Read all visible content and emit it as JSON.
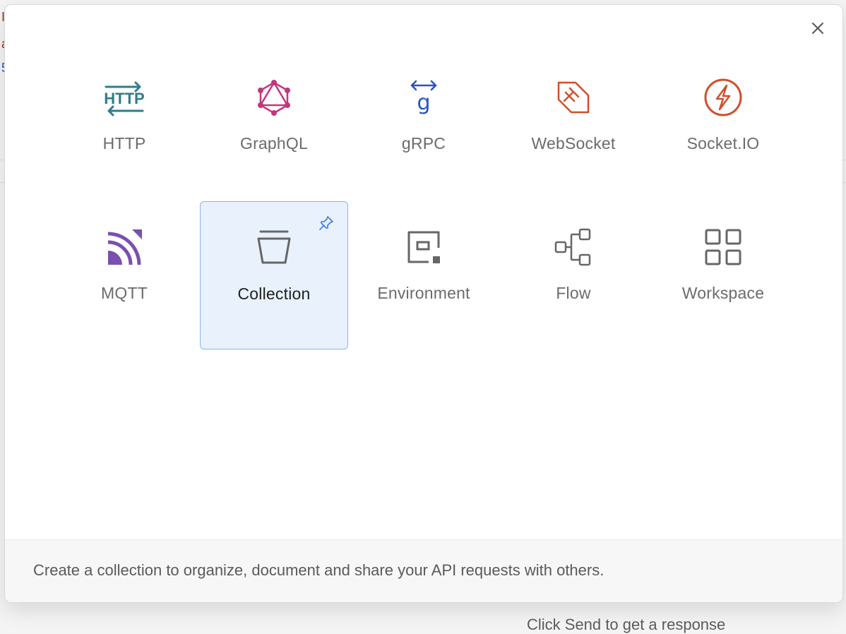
{
  "background": {
    "peek_chars": [
      "I",
      "a",
      "5"
    ],
    "hint": "Click Send to get a response"
  },
  "modal": {
    "close_label": "×",
    "tiles": [
      {
        "key": "http",
        "label": "HTTP",
        "icon": "http-icon",
        "color": "#2e7d8a",
        "selected": false
      },
      {
        "key": "graphql",
        "label": "GraphQL",
        "icon": "graphql-icon",
        "color": "#c2367d",
        "selected": false
      },
      {
        "key": "grpc",
        "label": "gRPC",
        "icon": "grpc-icon",
        "color": "#2a52be",
        "selected": false
      },
      {
        "key": "websocket",
        "label": "WebSocket",
        "icon": "websocket-icon",
        "color": "#d04f2a",
        "selected": false
      },
      {
        "key": "socketio",
        "label": "Socket.IO",
        "icon": "socketio-icon",
        "color": "#d04f2a",
        "selected": false
      },
      {
        "key": "mqtt",
        "label": "MQTT",
        "icon": "mqtt-icon",
        "color": "#7a4fb0",
        "selected": false
      },
      {
        "key": "collection",
        "label": "Collection",
        "icon": "collection-icon",
        "color": "#6b6b6b",
        "selected": true
      },
      {
        "key": "environment",
        "label": "Environment",
        "icon": "environment-icon",
        "color": "#6b6b6b",
        "selected": false
      },
      {
        "key": "flow",
        "label": "Flow",
        "icon": "flow-icon",
        "color": "#6b6b6b",
        "selected": false
      },
      {
        "key": "workspace",
        "label": "Workspace",
        "icon": "workspace-icon",
        "color": "#6b6b6b",
        "selected": false
      }
    ],
    "pin_icon": "pin-icon",
    "accent": "#8db4ea",
    "description": "Create a collection to organize, document and share your API requests with others."
  }
}
